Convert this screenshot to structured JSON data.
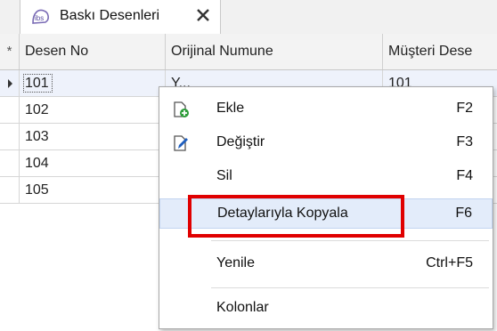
{
  "tab": {
    "title": "Baskı Desenleri",
    "icon": "app-logo-icon",
    "close_icon": "close-icon"
  },
  "grid": {
    "columns": [
      "*",
      "Desen No",
      "Orijinal Numune",
      "Müşteri Dese"
    ],
    "rows": [
      {
        "desen_no": "101",
        "orijinal": "Y...",
        "musteri": "101",
        "selected": true
      },
      {
        "desen_no": "102",
        "orijinal": "",
        "musteri": ""
      },
      {
        "desen_no": "103",
        "orijinal": "",
        "musteri": ""
      },
      {
        "desen_no": "104",
        "orijinal": "",
        "musteri": ""
      },
      {
        "desen_no": "105",
        "orijinal": "",
        "musteri": ""
      }
    ]
  },
  "context_menu": {
    "items": [
      {
        "label": "Ekle",
        "shortcut": "F2",
        "icon": "add-icon"
      },
      {
        "label": "Değiştir",
        "shortcut": "F3",
        "icon": "edit-icon"
      },
      {
        "label": "Sil",
        "shortcut": "F4"
      },
      {
        "label": "Detaylarıyla Kopyala",
        "shortcut": "F6",
        "highlighted": true
      },
      {
        "label": "Yenile",
        "shortcut": "Ctrl+F5"
      },
      {
        "label": "Kolonlar",
        "shortcut": ""
      }
    ]
  },
  "colors": {
    "highlight_border": "#e00000",
    "hover_bg": "#e3ecfa",
    "add_icon_green": "#2e9d3a",
    "edit_icon_blue": "#1f5fbf"
  }
}
